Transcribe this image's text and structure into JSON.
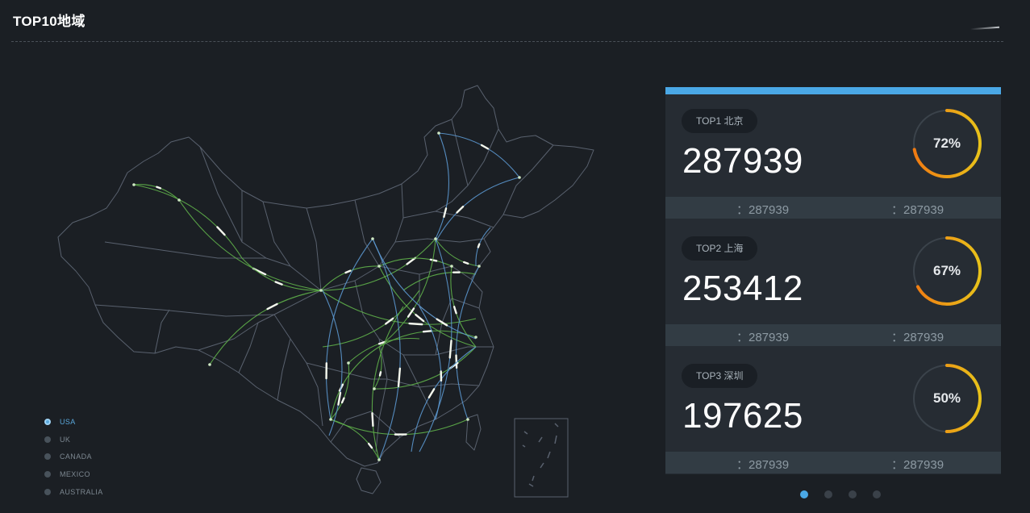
{
  "header": {
    "title": "TOP10地域"
  },
  "legend": [
    {
      "label": "USA",
      "active": true
    },
    {
      "label": "UK",
      "active": false
    },
    {
      "label": "CANADA",
      "active": false
    },
    {
      "label": "MEXICO",
      "active": false
    },
    {
      "label": "AUSTRALIA",
      "active": false
    }
  ],
  "ranking": [
    {
      "rank_label": "TOP1 北京",
      "value": "287939",
      "percent_label": "72%",
      "percent": 0.72,
      "stat_left": "：287939",
      "stat_right": "：287939"
    },
    {
      "rank_label": "TOP2 上海",
      "value": "253412",
      "percent_label": "67%",
      "percent": 0.67,
      "stat_left": "：287939",
      "stat_right": "：287939"
    },
    {
      "rank_label": "TOP3 深圳",
      "value": "197625",
      "percent_label": "50%",
      "percent": 0.5,
      "stat_left": "：287939",
      "stat_right": "：287939"
    }
  ],
  "pager": {
    "pages": 4,
    "current": 1
  },
  "colors": {
    "accent_blue": "#4aa8e6",
    "flow_green": "#5fb04a",
    "flow_blue": "#5b97cf",
    "ring_orange": "#f07a12",
    "ring_yellow": "#e8c21a",
    "map_outline": "#59616e"
  }
}
